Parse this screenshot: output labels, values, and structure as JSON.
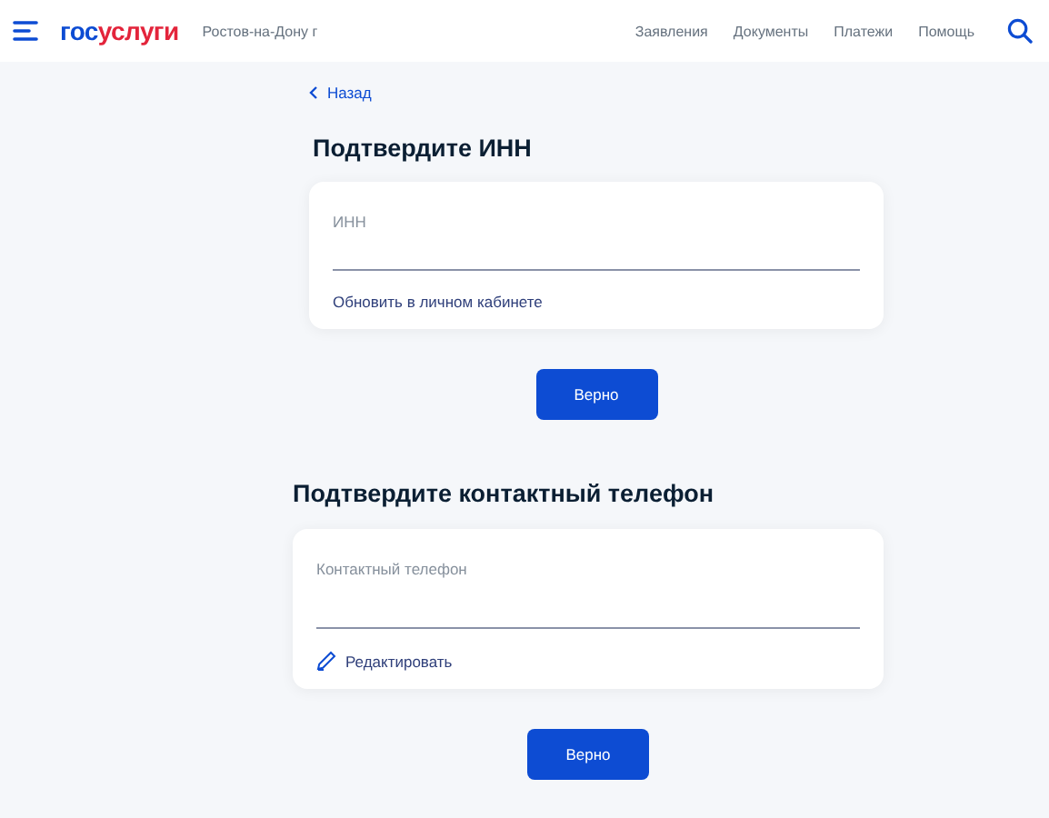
{
  "header": {
    "logo": [
      {
        "text": "гос",
        "color": "#0d4cd3"
      },
      {
        "text": "услуги",
        "color": "#e3243b"
      }
    ],
    "city": "Ростов-на-Дону г",
    "nav": [
      "Заявления",
      "Документы",
      "Платежи",
      "Помощь"
    ]
  },
  "back": "Назад",
  "sections": [
    {
      "title": "Подтвердите ИНН",
      "field_label": "ИНН",
      "link": {
        "kind": "plain",
        "text": "Обновить в личном кабинете"
      },
      "button": "Верно"
    },
    {
      "title": "Подтвердите контактный телефон",
      "field_label": "Контактный телефон",
      "link": {
        "kind": "edit",
        "text": "Редактировать"
      },
      "button": "Верно"
    }
  ]
}
